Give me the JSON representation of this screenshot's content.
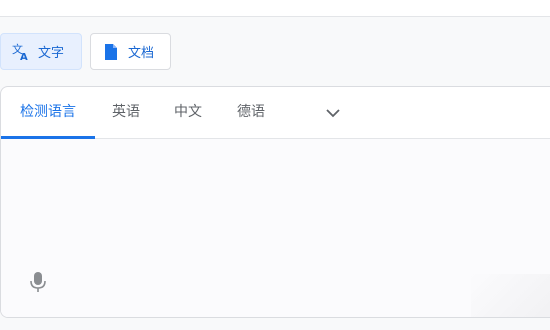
{
  "modes": {
    "text_label": "文字",
    "doc_label": "文档"
  },
  "languages": {
    "tabs": [
      "检测语言",
      "英语",
      "中文",
      "德语"
    ],
    "active_index": 0
  },
  "icons": {
    "text_mode": "translate-icon",
    "doc_mode": "document-icon",
    "more_languages": "chevron-down-icon",
    "voice": "microphone-icon"
  },
  "colors": {
    "accent": "#1a73e8",
    "active_bg": "#e8f0fe"
  }
}
